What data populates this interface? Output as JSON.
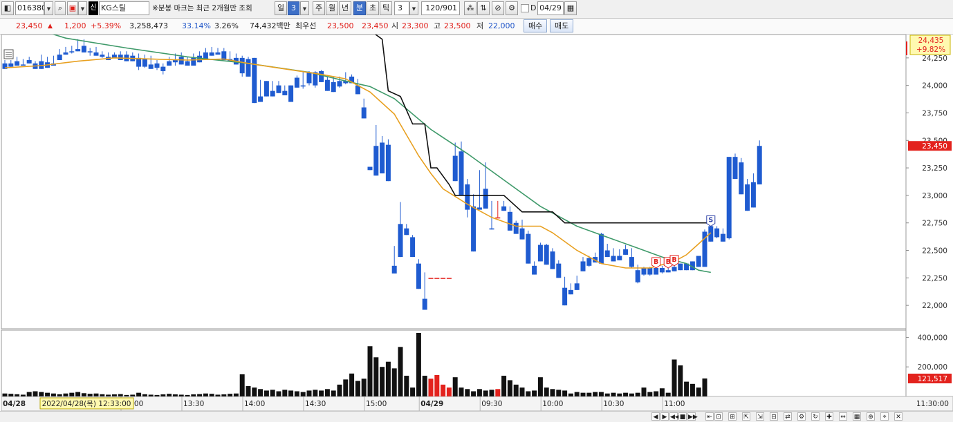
{
  "toolbar": {
    "stock_code": "016380",
    "credit_label": "신",
    "stock_name": "KG스틸",
    "notice": "※분봉 마크는 최근 2개월만 조회",
    "period_day": "일",
    "period_day_n": "3",
    "period_week": "주",
    "period_month": "월",
    "period_year": "년",
    "period_minute": "분",
    "period_second": "초",
    "period_tick": "틱",
    "interval_value": "3",
    "count_display": "120/901",
    "d_label": "D",
    "date_value": "04/29"
  },
  "info": {
    "price": "23,450",
    "change_arrow": "▲",
    "change": "1,200",
    "change_pct": "+5.39%",
    "volume": "3,258,473",
    "rate1": "33.14%",
    "rate2": "3.26%",
    "amount": "74,432백만",
    "best_label": "최우선",
    "best_ask": "23,500",
    "best_bid": "23,450",
    "open_label": "시",
    "open": "23,300",
    "high_label": "고",
    "high": "23,500",
    "low_label": "저",
    "low": "22,000",
    "buy_label": "매수",
    "sell_label": "매도"
  },
  "colors": {
    "up": "#e3221d",
    "down": "#1f5bd0",
    "ma_short": "#e8a020",
    "ma_long": "#3f9a6a",
    "line_black": "#111111",
    "vol_black": "#111111"
  },
  "chart_data": {
    "type": "candlestick",
    "price_ylim": [
      21800,
      24450
    ],
    "volume_ylim": [
      0,
      430000
    ],
    "price_ticks": [
      24250,
      24000,
      23750,
      23500,
      23250,
      23000,
      22750,
      22500,
      22250,
      22000
    ],
    "price_tick_labels": [
      "24,250",
      "24,000",
      "23,750",
      "23,500",
      "23,250",
      "23,000",
      "22,750",
      "22,500",
      "22,250",
      "22,000"
    ],
    "volume_ticks": [
      400000,
      200000
    ],
    "volume_tick_labels": [
      "400,000",
      "200,000"
    ],
    "current_price": 23450,
    "current_price_label": "23,450",
    "max_label": "24,435",
    "max_pct_label": "+9.82%",
    "current_volume_label": "121,517",
    "time_labels": [
      {
        "text": "04/28",
        "bar": 0,
        "bold": true
      },
      {
        "text": "13:00",
        "bar": 20
      },
      {
        "text": "13:30",
        "bar": 30
      },
      {
        "text": "14:00",
        "bar": 40
      },
      {
        "text": "14:30",
        "bar": 50
      },
      {
        "text": "15:00",
        "bar": 60
      },
      {
        "text": "04/29",
        "bar": 69,
        "bold": true
      },
      {
        "text": "09:30",
        "bar": 79
      },
      {
        "text": "10:00",
        "bar": 89
      },
      {
        "text": "10:30",
        "bar": 99
      },
      {
        "text": "11:00",
        "bar": 109
      }
    ],
    "cursor_date_label": "2022/04/28(목) 12:33:00",
    "axis_end_label": "11:30:00",
    "candles": [
      [
        24200,
        24230,
        24160,
        24150
      ],
      [
        24200,
        24230,
        24160,
        24170
      ],
      [
        24220,
        24260,
        24190,
        24180
      ],
      [
        24190,
        24240,
        24180,
        24180
      ],
      [
        24230,
        24260,
        24210,
        24200
      ],
      [
        24200,
        24220,
        24170,
        24150
      ],
      [
        24220,
        24280,
        24160,
        24150
      ],
      [
        24210,
        24260,
        24160,
        24160
      ],
      [
        24200,
        24270,
        24180,
        24180
      ],
      [
        24280,
        24330,
        24230,
        24230
      ],
      [
        24300,
        24350,
        24280,
        24280
      ],
      [
        24310,
        24360,
        24290,
        24300
      ],
      [
        24330,
        24420,
        24310,
        24310
      ],
      [
        24360,
        24420,
        24300,
        24300
      ],
      [
        24310,
        24340,
        24270,
        24300
      ],
      [
        24300,
        24350,
        24270,
        24270
      ],
      [
        24280,
        24310,
        24250,
        24260
      ],
      [
        24260,
        24300,
        24230,
        24230
      ],
      [
        24280,
        24300,
        24250,
        24250
      ],
      [
        24280,
        24310,
        24230,
        24230
      ],
      [
        24280,
        24310,
        24220,
        24220
      ],
      [
        24270,
        24300,
        24230,
        24220
      ],
      [
        24250,
        24290,
        24140,
        24170
      ],
      [
        24240,
        24280,
        24160,
        24170
      ],
      [
        24190,
        24270,
        24160,
        24150
      ],
      [
        24200,
        24230,
        24140,
        24160
      ],
      [
        24170,
        24200,
        24100,
        24130
      ],
      [
        24220,
        24260,
        24180,
        24180
      ],
      [
        24230,
        24290,
        24180,
        24210
      ],
      [
        24260,
        24300,
        24190,
        24190
      ],
      [
        24220,
        24260,
        24180,
        24180
      ],
      [
        24250,
        24290,
        24180,
        24180
      ],
      [
        24270,
        24310,
        24210,
        24210
      ],
      [
        24300,
        24340,
        24250,
        24240
      ],
      [
        24300,
        24350,
        24270,
        24270
      ],
      [
        24300,
        24340,
        24280,
        24280
      ],
      [
        24310,
        24340,
        24230,
        24230
      ],
      [
        24240,
        24310,
        24220,
        24220
      ],
      [
        24250,
        24290,
        24190,
        24190
      ],
      [
        24250,
        24270,
        24080,
        24110
      ],
      [
        24240,
        24260,
        24080,
        24080
      ],
      [
        24250,
        23960,
        23860,
        23840
      ],
      [
        23900,
        24050,
        23850,
        23850
      ],
      [
        24040,
        24040,
        23900,
        23900
      ],
      [
        23950,
        24040,
        23900,
        23900
      ],
      [
        24000,
        24040,
        23930,
        23930
      ],
      [
        23950,
        24000,
        23910,
        23910
      ],
      [
        24000,
        23990,
        23850,
        23850
      ],
      [
        24070,
        24090,
        23980,
        23980
      ],
      [
        24000,
        24120,
        23970,
        23990
      ],
      [
        24120,
        24130,
        24000,
        24020
      ],
      [
        24120,
        24130,
        23980,
        24000
      ],
      [
        24130,
        24140,
        24030,
        24030
      ],
      [
        24050,
        24080,
        23950,
        23950
      ],
      [
        24030,
        24080,
        23980,
        23940
      ],
      [
        24040,
        24080,
        23980,
        23990
      ],
      [
        24040,
        24120,
        24010,
        24020
      ],
      [
        24080,
        24100,
        24020,
        24020
      ],
      [
        24000,
        24060,
        23920,
        23920
      ],
      [
        23800,
        23880,
        23700,
        23700
      ],
      [
        23260,
        23250,
        23230,
        23230
      ],
      [
        23450,
        23640,
        23280,
        23180
      ],
      [
        23480,
        23540,
        23300,
        23200
      ],
      [
        23460,
        23510,
        23230,
        23130
      ],
      [
        22360,
        22540,
        22310,
        22290
      ],
      [
        22740,
        22940,
        22440,
        22440
      ],
      [
        22700,
        22740,
        22640,
        22640
      ],
      [
        22620,
        22640,
        22440,
        22440
      ],
      [
        22380,
        22420,
        22150,
        22150
      ],
      [
        22060,
        22300,
        22050,
        21960
      ],
      [
        22250,
        22240,
        22250,
        22250
      ],
      [
        22250,
        22240,
        22250,
        22250
      ],
      [
        22250,
        22240,
        22250,
        22250
      ],
      [
        22250,
        22240,
        22250,
        22250
      ],
      [
        23360,
        23480,
        23130,
        23130
      ],
      [
        23400,
        23490,
        23250,
        23000
      ],
      [
        23100,
        23150,
        22800,
        22870
      ],
      [
        22900,
        23010,
        22500,
        22490
      ],
      [
        22890,
        23230,
        22870,
        22870
      ],
      [
        23060,
        23300,
        22950,
        22880
      ],
      [
        22700,
        22950,
        22690,
        22690
      ],
      [
        22800,
        22950,
        22800,
        22800
      ],
      [
        22900,
        22950,
        22860,
        22860
      ],
      [
        22850,
        22900,
        22680,
        22680
      ],
      [
        22750,
        22770,
        22650,
        22650
      ],
      [
        22700,
        22780,
        22600,
        22600
      ],
      [
        22650,
        22680,
        22380,
        22380
      ],
      [
        22360,
        22400,
        22280,
        22280
      ],
      [
        22550,
        22570,
        22400,
        22400
      ],
      [
        22550,
        22560,
        22370,
        22370
      ],
      [
        22490,
        22520,
        22330,
        22330
      ],
      [
        22380,
        22410,
        22250,
        22250
      ],
      [
        22160,
        22260,
        22000,
        22000
      ],
      [
        22140,
        22200,
        22100,
        22100
      ],
      [
        22200,
        22270,
        22140,
        22140
      ],
      [
        22400,
        22440,
        22310,
        22310
      ],
      [
        22430,
        22450,
        22350,
        22360
      ],
      [
        22440,
        22480,
        22390,
        22390
      ],
      [
        22650,
        22660,
        22380,
        22380
      ],
      [
        22500,
        22560,
        22440,
        22440
      ],
      [
        22450,
        22520,
        22400,
        22400
      ],
      [
        22450,
        22510,
        22410,
        22410
      ],
      [
        22510,
        22550,
        22460,
        22460
      ],
      [
        22440,
        22520,
        22340,
        22350
      ],
      [
        22320,
        22370,
        22200,
        22210
      ],
      [
        22340,
        22350,
        22270,
        22280
      ],
      [
        22340,
        22350,
        22270,
        22280
      ],
      [
        22340,
        22340,
        22280,
        22280
      ],
      [
        22340,
        22360,
        22290,
        22300
      ],
      [
        22320,
        22340,
        22300,
        22300
      ],
      [
        22350,
        22360,
        22310,
        22310
      ],
      [
        22380,
        22380,
        22320,
        22320
      ],
      [
        22380,
        22380,
        22320,
        22320
      ],
      [
        22400,
        22400,
        22320,
        22320
      ],
      [
        22450,
        22450,
        22350,
        22350
      ],
      [
        22670,
        22690,
        22350,
        22350
      ],
      [
        22720,
        22720,
        22580,
        22580
      ],
      [
        22700,
        22720,
        22610,
        22620
      ],
      [
        22650,
        22700,
        22580,
        22580
      ],
      [
        23350,
        23350,
        22600,
        22610
      ],
      [
        23350,
        23380,
        23150,
        23150
      ],
      [
        23300,
        23340,
        23010,
        23010
      ],
      [
        23100,
        23150,
        22860,
        22860
      ],
      [
        23120,
        23200,
        22890,
        22890
      ],
      [
        23450,
        23500,
        23100,
        23100
      ]
    ],
    "volume": [
      20000,
      18000,
      15000,
      12000,
      30000,
      35000,
      30000,
      25000,
      20000,
      15000,
      20000,
      25000,
      30000,
      22000,
      18000,
      20000,
      15000,
      12000,
      14000,
      16000,
      10000,
      12000,
      25000,
      15000,
      12000,
      10000,
      14000,
      18000,
      14000,
      12000,
      10000,
      14000,
      16000,
      20000,
      18000,
      12000,
      14000,
      18000,
      20000,
      150000,
      70000,
      60000,
      50000,
      40000,
      45000,
      35000,
      45000,
      40000,
      35000,
      30000,
      40000,
      45000,
      40000,
      50000,
      40000,
      80000,
      115000,
      155000,
      105000,
      120000,
      340000,
      265000,
      200000,
      235000,
      190000,
      335000,
      140000,
      60000,
      430000,
      140000,
      120000,
      145000,
      80000,
      60000,
      130000,
      60000,
      50000,
      35000,
      50000,
      40000,
      45000,
      50000,
      140000,
      110000,
      80000,
      60000,
      35000,
      40000,
      130000,
      60000,
      50000,
      45000,
      40000,
      20000,
      30000,
      25000,
      25000,
      30000,
      30000,
      20000,
      25000,
      20000,
      25000,
      20000,
      25000,
      60000,
      30000,
      35000,
      55000,
      25000,
      250000,
      210000,
      100000,
      85000,
      60000,
      121517
    ],
    "ma_short": [
      [
        0,
        24160
      ],
      [
        6,
        24180
      ],
      [
        12,
        24220
      ],
      [
        18,
        24250
      ],
      [
        24,
        24240
      ],
      [
        30,
        24230
      ],
      [
        36,
        24240
      ],
      [
        40,
        24200
      ],
      [
        46,
        24150
      ],
      [
        52,
        24100
      ],
      [
        56,
        24060
      ],
      [
        60,
        23940
      ],
      [
        64,
        23740
      ],
      [
        68,
        23360
      ],
      [
        70,
        23200
      ],
      [
        72,
        23060
      ],
      [
        76,
        22920
      ],
      [
        80,
        22800
      ],
      [
        84,
        22720
      ],
      [
        88,
        22720
      ],
      [
        90,
        22660
      ],
      [
        94,
        22500
      ],
      [
        98,
        22380
      ],
      [
        102,
        22340
      ],
      [
        106,
        22340
      ],
      [
        110,
        22400
      ],
      [
        112,
        22460
      ],
      [
        114,
        22560
      ],
      [
        116,
        22660
      ]
    ],
    "ma_long": [
      [
        0,
        24600
      ],
      [
        10,
        24430
      ],
      [
        20,
        24340
      ],
      [
        30,
        24260
      ],
      [
        40,
        24200
      ],
      [
        50,
        24120
      ],
      [
        56,
        24040
      ],
      [
        60,
        23990
      ],
      [
        64,
        23880
      ],
      [
        70,
        23600
      ],
      [
        76,
        23380
      ],
      [
        82,
        23140
      ],
      [
        88,
        22900
      ],
      [
        94,
        22720
      ],
      [
        100,
        22600
      ],
      [
        104,
        22520
      ],
      [
        108,
        22440
      ],
      [
        112,
        22380
      ],
      [
        114,
        22320
      ],
      [
        116,
        22300
      ]
    ],
    "line_black": [
      [
        55,
        24600
      ],
      [
        56,
        24520
      ],
      [
        60,
        24500
      ],
      [
        62,
        24420
      ],
      [
        63,
        23950
      ],
      [
        65,
        23900
      ],
      [
        67,
        23650
      ],
      [
        69,
        23650
      ],
      [
        70,
        23250
      ],
      [
        71,
        23250
      ],
      [
        73,
        23100
      ],
      [
        74,
        23000
      ],
      [
        82,
        23000
      ],
      [
        85,
        22850
      ],
      [
        90,
        22850
      ],
      [
        92,
        22750
      ],
      [
        116,
        22750
      ]
    ],
    "buy_marks": [
      107,
      109,
      110
    ],
    "sell_marks": [
      116
    ],
    "buy_mark_label": "B",
    "sell_mark_label": "S"
  },
  "bottombar": {
    "buttons": [
      "◀",
      "▶",
      "◀◀",
      "■",
      "▶▶",
      "⇤",
      "⊡",
      "⊞",
      "⇱",
      "⇲",
      "⊟",
      "⇄",
      "⚙",
      "↻",
      "✚",
      "⇔",
      "▦",
      "⊕",
      "⌖",
      "✕"
    ]
  }
}
